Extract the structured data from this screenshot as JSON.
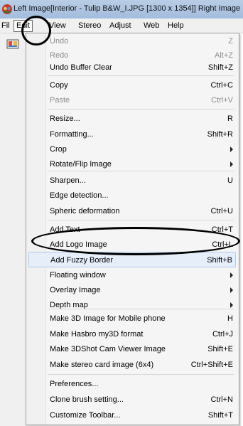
{
  "window": {
    "title": "Left Image[Interior - Tulip B&W_I.JPG [1300 x 1354]] Right Image"
  },
  "menubar": {
    "items": [
      {
        "label": "File"
      },
      {
        "label": "Edit",
        "active": true
      },
      {
        "label": "View"
      },
      {
        "label": "Stereo"
      },
      {
        "label": "Adjust"
      },
      {
        "label": "Web"
      },
      {
        "label": "Help"
      }
    ]
  },
  "edit_menu": {
    "items": [
      {
        "label": "Undo",
        "shortcut": "Z",
        "disabled": true
      },
      {
        "label": "Redo",
        "shortcut": "Alt+Z",
        "disabled": true
      },
      {
        "label": "Undo Buffer Clear",
        "shortcut": "Shift+Z"
      },
      {
        "label": "Copy",
        "shortcut": "Ctrl+C"
      },
      {
        "label": "Paste",
        "shortcut": "Ctrl+V",
        "disabled": true
      },
      {
        "label": "Resize...",
        "shortcut": "R"
      },
      {
        "label": "Formatting...",
        "shortcut": "Shift+R"
      },
      {
        "label": "Crop",
        "submenu": true
      },
      {
        "label": "Rotate/Flip Image",
        "submenu": true
      },
      {
        "label": "Sharpen...",
        "shortcut": "U"
      },
      {
        "label": "Edge detection..."
      },
      {
        "label": "Spheric deformation",
        "shortcut": "Ctrl+U"
      },
      {
        "label": "Add Text",
        "shortcut": "Ctrl+T"
      },
      {
        "label": "Add Logo Image",
        "shortcut": "Ctrl+L"
      },
      {
        "label": "Add Fuzzy Border",
        "shortcut": "Shift+B",
        "highlighted": true
      },
      {
        "label": "Floating window",
        "submenu": true
      },
      {
        "label": "Overlay Image",
        "submenu": true
      },
      {
        "label": "Depth map",
        "submenu": true
      },
      {
        "label": "Make 3D Image for Mobile phone",
        "shortcut": "H"
      },
      {
        "label": "Make Hasbro my3D format",
        "shortcut": "Ctrl+J"
      },
      {
        "label": "Make 3DShot Cam Viewer Image",
        "shortcut": "Shift+E"
      },
      {
        "label": "Make stereo card image (6x4)",
        "shortcut": "Ctrl+Shift+E"
      },
      {
        "label": "Preferences..."
      },
      {
        "label": "Clone brush setting...",
        "shortcut": "Ctrl+N"
      },
      {
        "label": "Customize Toolbar...",
        "shortcut": "Shift+T"
      }
    ]
  },
  "icons": {
    "app": "stereo-photo-maker-icon",
    "toolbar": "open-image-icon"
  },
  "colors": {
    "highlight_fill": "#e6eefa",
    "highlight_border": "#aecaf0",
    "annotation": "#000000"
  }
}
